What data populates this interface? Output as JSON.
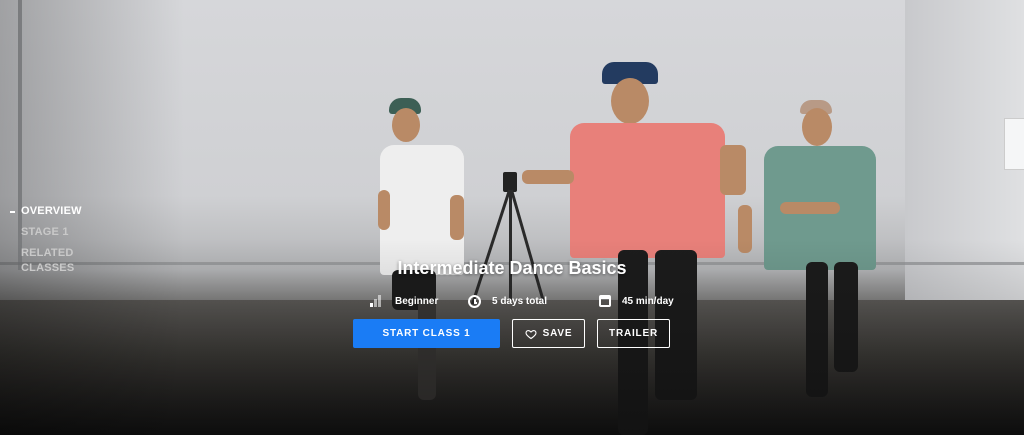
{
  "section_nav": {
    "items": [
      {
        "label": "OVERVIEW",
        "active": true
      },
      {
        "label": "STAGE 1",
        "active": false
      },
      {
        "label": "RELATED CLASSES",
        "active": false
      }
    ]
  },
  "course": {
    "title": "Intermediate Dance Basics",
    "level": "Beginner",
    "duration": "5 days total",
    "daily_time": "45 min/day"
  },
  "actions": {
    "start_label": "START CLASS 1",
    "save_label": "SAVE",
    "trailer_label": "TRAILER"
  },
  "colors": {
    "accent": "#1a7cf5",
    "text": "#ffffff"
  }
}
